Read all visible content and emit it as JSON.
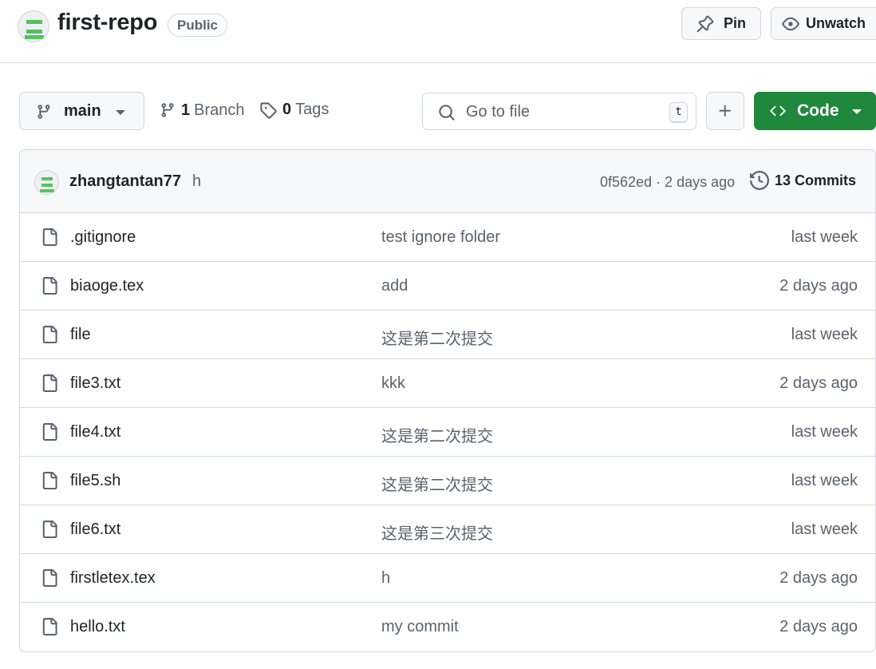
{
  "header": {
    "repo_name": "first-repo",
    "visibility": "Public",
    "pin_label": "Pin",
    "unwatch_label": "Unwatch"
  },
  "toolbar": {
    "branch_name": "main",
    "branch_count": "1",
    "branch_label": "Branch",
    "tag_count": "0",
    "tag_label": "Tags",
    "search_placeholder": "Go to file",
    "search_shortcut": "t",
    "code_label": "Code"
  },
  "latest_commit": {
    "author": "zhangtantan77",
    "message": "h",
    "meta": "0f562ed · 2 days ago",
    "commits_label": "13 Commits"
  },
  "files": [
    {
      "name": ".gitignore",
      "message": "test ignore folder",
      "date": "last week"
    },
    {
      "name": "biaoge.tex",
      "message": "add",
      "date": "2 days ago"
    },
    {
      "name": "file",
      "message": "这是第二次提交",
      "date": "last week"
    },
    {
      "name": "file3.txt",
      "message": "kkk",
      "date": "2 days ago"
    },
    {
      "name": "file4.txt",
      "message": "这是第二次提交",
      "date": "last week"
    },
    {
      "name": "file5.sh",
      "message": "这是第二次提交",
      "date": "last week"
    },
    {
      "name": "file6.txt",
      "message": "这是第三次提交",
      "date": "last week"
    },
    {
      "name": "firstletex.tex",
      "message": "h",
      "date": "2 days ago"
    },
    {
      "name": "hello.txt",
      "message": "my commit",
      "date": "2 days ago"
    }
  ],
  "colors": {
    "accent_green": "#1f883d",
    "border": "#d0d7de",
    "muted_text": "#59636e",
    "avatar_green": "#54c25f"
  }
}
